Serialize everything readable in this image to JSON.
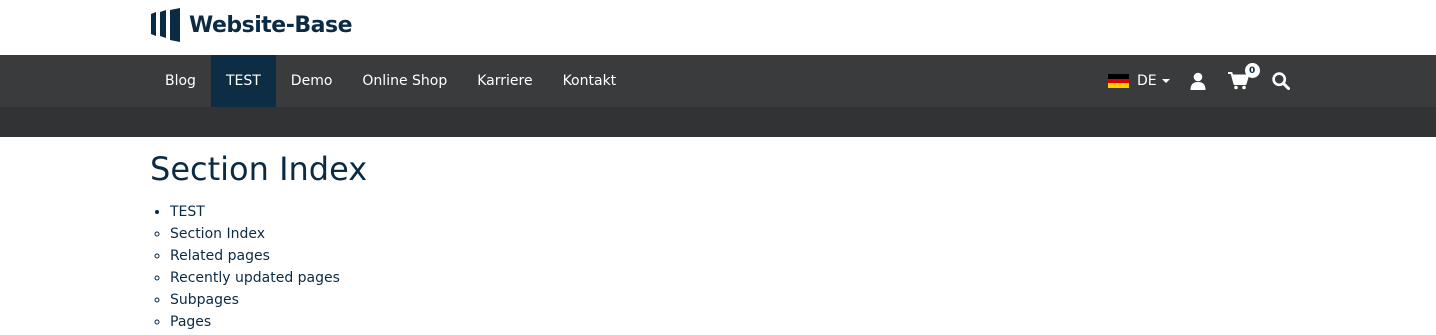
{
  "brand": {
    "name": "Website-Base",
    "colors": {
      "primary": "#0b2b45",
      "navbar": "#3a3b3c",
      "subbar": "#323334",
      "active": "#0d2d45"
    }
  },
  "nav": {
    "items": [
      {
        "label": "Blog",
        "active": false
      },
      {
        "label": "TEST",
        "active": true
      },
      {
        "label": "Demo",
        "active": false
      },
      {
        "label": "Online Shop",
        "active": false
      },
      {
        "label": "Karriere",
        "active": false
      },
      {
        "label": "Kontakt",
        "active": false
      }
    ]
  },
  "tools": {
    "language": "DE",
    "flag_icon": "germany-flag-icon",
    "user_icon": "user-icon",
    "cart_icon": "cart-icon",
    "cart_count": "0",
    "search_icon": "search-icon"
  },
  "main": {
    "title": "Section Index",
    "parent": "TEST",
    "links": [
      "Section Index",
      "Related pages",
      "Recently updated pages",
      "Subpages",
      "Pages"
    ]
  }
}
